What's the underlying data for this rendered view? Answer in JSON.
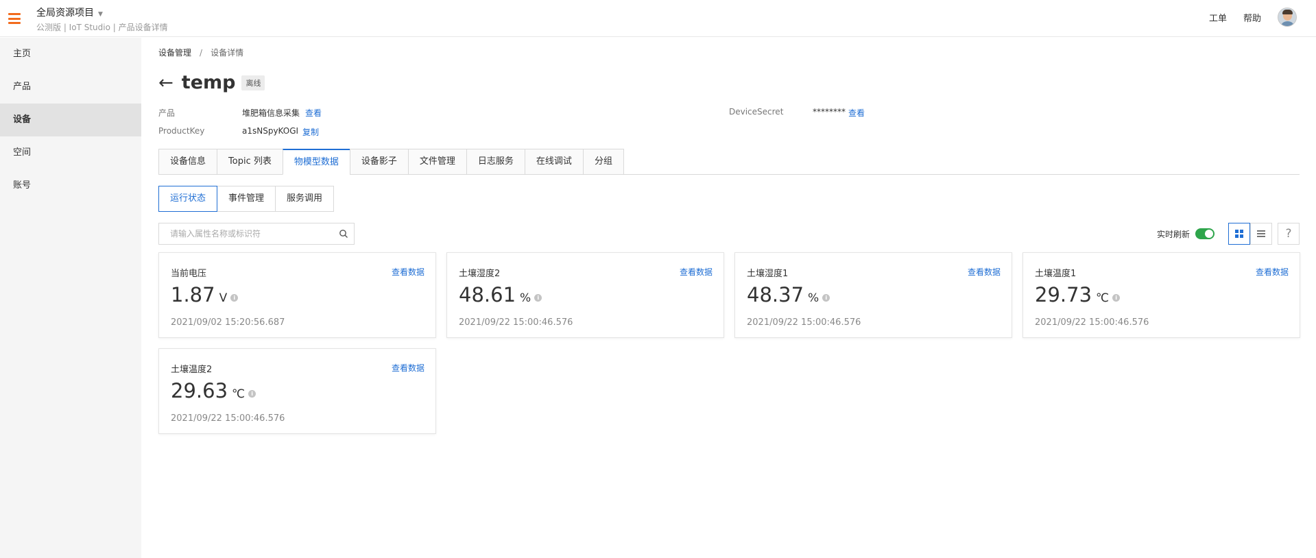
{
  "header": {
    "project_title": "全局资源项目",
    "project_subtitle": "公测版 | IoT Studio | 产品设备详情",
    "ticket_label": "工单",
    "help_label": "帮助"
  },
  "sidebar": {
    "items": [
      {
        "label": "主页"
      },
      {
        "label": "产品"
      },
      {
        "label": "设备"
      },
      {
        "label": "空间"
      },
      {
        "label": "账号"
      }
    ],
    "active_index": 2
  },
  "breadcrumb": {
    "parent": "设备管理",
    "separator": "/",
    "current": "设备详情"
  },
  "device": {
    "name": "temp",
    "status": "离线",
    "product_label": "产品",
    "product_value": "堆肥箱信息采集",
    "product_link": "查看",
    "productkey_label": "ProductKey",
    "productkey_value": "a1sNSpyKOGI",
    "productkey_link": "复制",
    "secret_label": "DeviceSecret",
    "secret_value": "********",
    "secret_link": "查看"
  },
  "tabs": [
    {
      "label": "设备信息"
    },
    {
      "label": "Topic 列表"
    },
    {
      "label": "物模型数据"
    },
    {
      "label": "设备影子"
    },
    {
      "label": "文件管理"
    },
    {
      "label": "日志服务"
    },
    {
      "label": "在线调试"
    },
    {
      "label": "分组"
    }
  ],
  "subtabs": [
    {
      "label": "运行状态"
    },
    {
      "label": "事件管理"
    },
    {
      "label": "服务调用"
    }
  ],
  "search": {
    "placeholder": "请输入属性名称或标识符"
  },
  "realtime": {
    "label": "实时刷新",
    "enabled": true
  },
  "cards": [
    {
      "name": "当前电压",
      "value": "1.87",
      "unit": "V",
      "time": "2021/09/02 15:20:56.687",
      "link": "查看数据"
    },
    {
      "name": "土壤湿度2",
      "value": "48.61",
      "unit": "%",
      "time": "2021/09/22 15:00:46.576",
      "link": "查看数据"
    },
    {
      "name": "土壤湿度1",
      "value": "48.37",
      "unit": "%",
      "time": "2021/09/22 15:00:46.576",
      "link": "查看数据"
    },
    {
      "name": "土壤温度1",
      "value": "29.73",
      "unit": "℃",
      "time": "2021/09/22 15:00:46.576",
      "link": "查看数据"
    },
    {
      "name": "土壤温度2",
      "value": "29.63",
      "unit": "℃",
      "time": "2021/09/22 15:00:46.576",
      "link": "查看数据"
    }
  ],
  "colors": {
    "accent": "#1f6ed4",
    "menu": "#f26b1d",
    "toggle_on": "#2ea54b"
  }
}
